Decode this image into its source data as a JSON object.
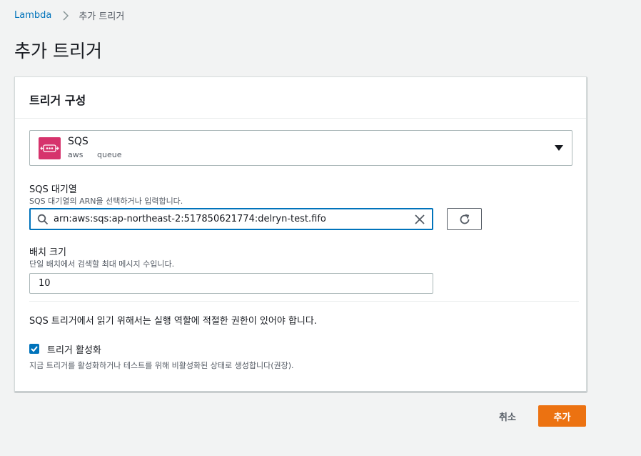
{
  "breadcrumb": {
    "root": "Lambda",
    "current": "추가 트리거"
  },
  "page_title": "추가 트리거",
  "card": {
    "title": "트리거 구성",
    "trigger_select": {
      "name": "SQS",
      "tags": [
        "aws",
        "queue"
      ],
      "icon": "sqs-icon",
      "icon_color": "#d6336c"
    },
    "queue_field": {
      "label": "SQS 대기열",
      "description": "SQS 대기열의 ARN을 선택하거나 입력합니다.",
      "value": "arn:aws:sqs:ap-northeast-2:517850621774:delryn-test.fifo"
    },
    "batch_field": {
      "label": "배치 크기",
      "description": "단일 배치에서 검색할 최대 메시지 수입니다.",
      "value": "10"
    },
    "permission_note": "SQS 트리거에서 읽기 위해서는 실행 역할에 적절한 권한이 있어야 합니다.",
    "enable_trigger": {
      "label": "트리거 활성화",
      "description": "지금 트리거를 활성화하거나 테스트를 위해 비활성화된 상태로 생성합니다(권장).",
      "checked": true
    }
  },
  "footer": {
    "cancel_label": "취소",
    "add_label": "추가"
  },
  "colors": {
    "accent": "#0073bb",
    "primary_button": "#ec7211"
  }
}
